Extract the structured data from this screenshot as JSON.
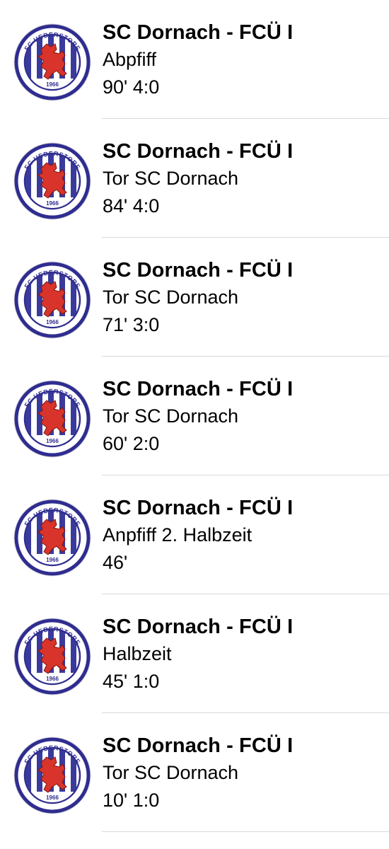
{
  "notifications": [
    {
      "title": "SC Dornach - FCÜ I",
      "event": "Abpfiff",
      "detail": "90' 4:0"
    },
    {
      "title": "SC Dornach - FCÜ I",
      "event": "Tor SC Dornach",
      "detail": "84' 4:0"
    },
    {
      "title": "SC Dornach - FCÜ I",
      "event": "Tor SC Dornach",
      "detail": "71' 3:0"
    },
    {
      "title": "SC Dornach - FCÜ I",
      "event": "Tor SC Dornach",
      "detail": "60' 2:0"
    },
    {
      "title": "SC Dornach - FCÜ I",
      "event": "Anpfiff 2. Halbzeit",
      "detail": "46'"
    },
    {
      "title": "SC Dornach - FCÜ I",
      "event": "Halbzeit",
      "detail": "45' 1:0"
    },
    {
      "title": "SC Dornach - FCÜ I",
      "event": "Tor SC Dornach",
      "detail": "10' 1:0"
    }
  ],
  "logo": {
    "top_text": "FC UEBERSTORF",
    "year": "1966",
    "icon": "club-crest-lion",
    "colors": {
      "ring": "#2f2d8f",
      "stripes": "#3a3a9c",
      "lion": "#d9342b"
    }
  }
}
